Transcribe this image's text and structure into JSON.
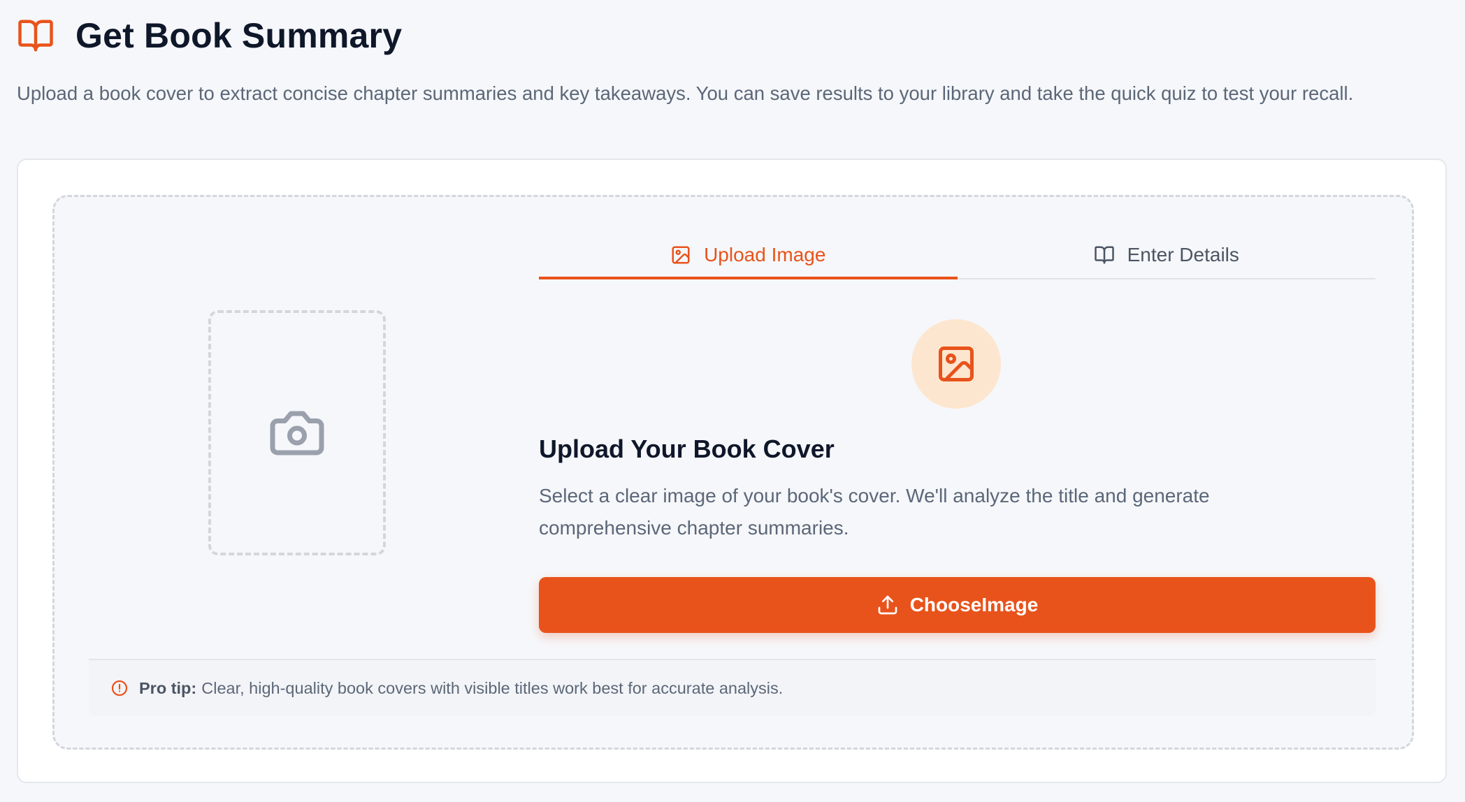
{
  "header": {
    "title": "Get Book Summary",
    "icon": "open-book-icon"
  },
  "intro": "Upload a book cover to extract concise chapter summaries and key takeaways. You can save results to your library and take the quick quiz to test your recall.",
  "preview": {
    "icon": "camera-icon"
  },
  "tabs": [
    {
      "label": "Upload Image",
      "icon": "image-icon",
      "active": true
    },
    {
      "label": "Enter Details",
      "icon": "book-open-icon",
      "active": false
    }
  ],
  "upload": {
    "icon": "image-icon",
    "title": "Upload Your Book Cover",
    "description": "Select a clear image of your book's cover. We'll analyze the title and generate comprehensive chapter summaries.",
    "button_label": "ChooseImage",
    "button_icon": "upload-icon"
  },
  "tip": {
    "icon": "alert-circle-icon",
    "label": "Pro tip:",
    "text": "Clear, high-quality book covers with visible titles work best for accurate analysis."
  },
  "colors": {
    "accent": "#e8531b",
    "accent_soft": "#fde6cf",
    "muted_text": "#5b6778",
    "background": "#f6f7fa"
  }
}
